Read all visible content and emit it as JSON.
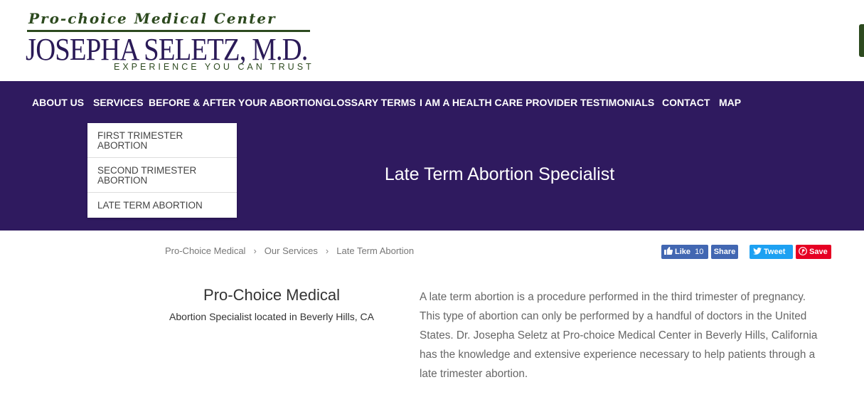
{
  "logo": {
    "script": "Pro-choice Medical Center",
    "name": "JOSEPHA SELETZ, M.D.",
    "tagline": "EXPERIENCE YOU CAN TRUST"
  },
  "nav": {
    "items": [
      "ABOUT US",
      "SERVICES",
      "BEFORE & AFTER YOUR ABORTION",
      "GLOSSARY TERMS",
      "I AM A HEALTH CARE PROVIDER",
      "TESTIMONIALS",
      "CONTACT",
      "MAP"
    ]
  },
  "dropdown": {
    "items": [
      {
        "line1": "FIRST TRIMESTER",
        "line2": "ABORTION"
      },
      {
        "line1": "SECOND TRIMESTER",
        "line2": "ABORTION"
      },
      {
        "line1": "LATE TERM ABORTION",
        "line2": ""
      }
    ]
  },
  "hero": {
    "title": "Late Term Abortion Specialist"
  },
  "breadcrumb": {
    "items": [
      "Pro-Choice Medical",
      "Our Services",
      "Late Term Abortion"
    ],
    "separator": "›"
  },
  "social": {
    "fb_like": "Like",
    "fb_like_count": "10",
    "fb_share": "Share",
    "tweet": "Tweet",
    "pin_save": "Save"
  },
  "sidebar": {
    "title": "Pro-Choice Medical",
    "subtitle": "Abortion Specialist located in Beverly Hills, CA"
  },
  "content": {
    "lines": [
      "A late term abortion is a procedure performed in the third trimester of pregnancy.",
      "This type of abortion can only be performed by a handful of doctors in the United",
      "States. Dr. Josepha Seletz at Pro-choice Medical Center in Beverly Hills, California",
      "has the knowledge and extensive experience necessary to help patients through a",
      "late trimester abortion."
    ]
  },
  "colors": {
    "nav_bg": "#2f1a5f",
    "logo_green": "#2d4a1f",
    "logo_purple": "#2a1a57",
    "facebook": "#4267b2",
    "twitter": "#1da1f2",
    "pinterest": "#e60023"
  }
}
